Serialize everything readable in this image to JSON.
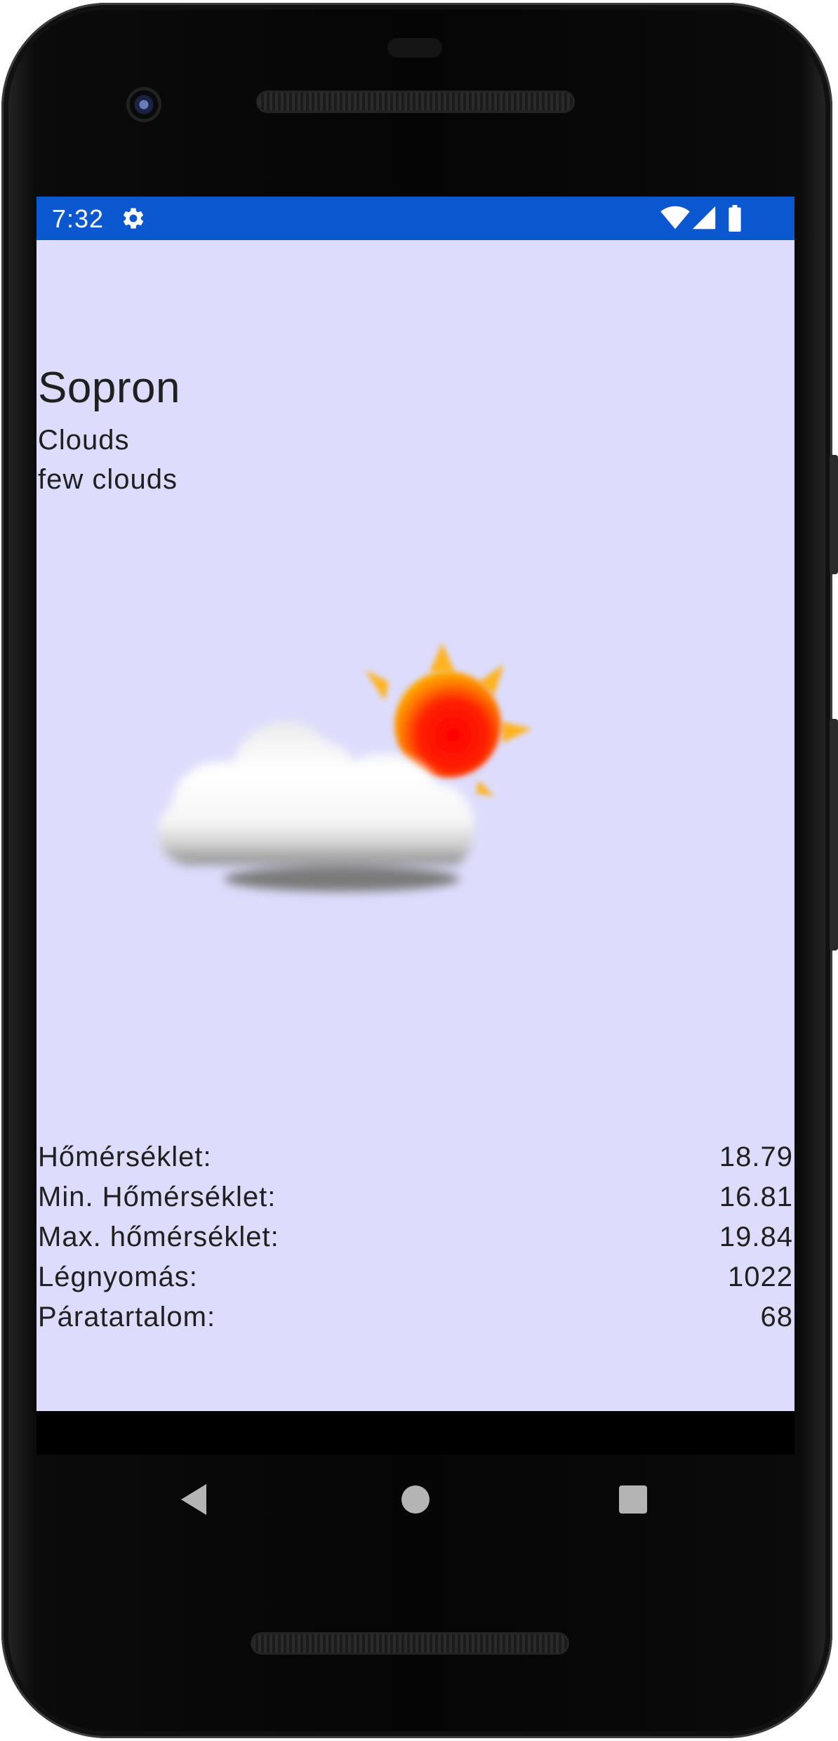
{
  "status_bar": {
    "time": "7:32",
    "color": "#0b57d0",
    "icons": [
      "gear-icon",
      "wifi-icon",
      "signal-icon",
      "battery-icon"
    ]
  },
  "weather": {
    "city": "Sopron",
    "main": "Clouds",
    "description": "few clouds",
    "icon": "partly-cloudy-icon",
    "background_color": "#dddcfc"
  },
  "details": [
    {
      "label": "Hőmérséklet:",
      "value": "18.79"
    },
    {
      "label": "Min. Hőmérséklet:",
      "value": "16.81"
    },
    {
      "label": "Max. hőmérséklet:",
      "value": "19.84"
    },
    {
      "label": "Légnyomás:",
      "value": "1022"
    },
    {
      "label": "Páratartalom:",
      "value": "68"
    }
  ],
  "nav_bar": {
    "icons": [
      "back-icon",
      "home-icon",
      "recents-icon"
    ]
  }
}
